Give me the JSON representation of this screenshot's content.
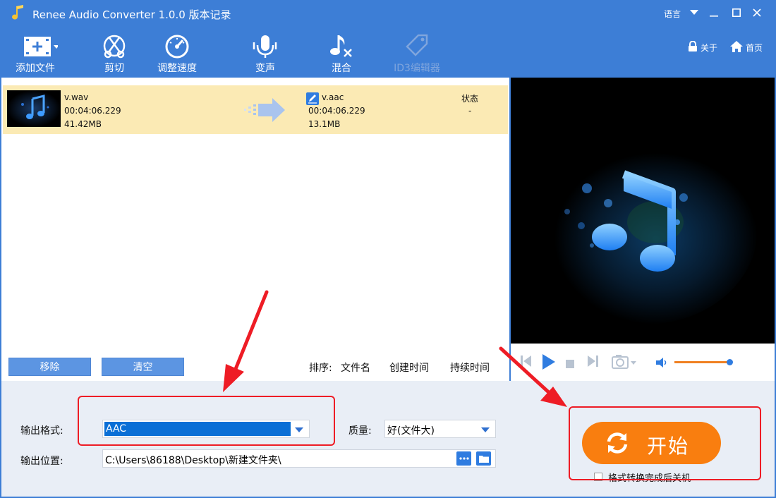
{
  "window": {
    "title": "Renee Audio Converter 1.0.0 版本记录",
    "language_label": "语言"
  },
  "toolbar": {
    "add_file": "添加文件",
    "cut": "剪切",
    "speed": "调整速度",
    "voice_change": "变声",
    "mix": "混合",
    "id3_editor": "ID3编辑器",
    "about": "关于",
    "home": "首页"
  },
  "file_list": {
    "items": [
      {
        "source_name": "v.wav",
        "source_duration": "00:04:06.229",
        "source_size": "41.42MB",
        "output_name": "v.aac",
        "output_duration": "00:04:06.229",
        "output_size": "13.1MB",
        "status_header": "状态",
        "status_value": "-"
      }
    ],
    "remove_label": "移除",
    "clear_label": "清空",
    "sort_label": "排序:",
    "sort_by_name": "文件名",
    "sort_by_created": "创建时间",
    "sort_by_duration": "持续时间"
  },
  "player": {
    "volume_level": 0.95
  },
  "settings": {
    "format_label": "输出格式:",
    "format_value": "AAC",
    "quality_label": "质量:",
    "quality_value": "好(文件大)",
    "location_label": "输出位置:",
    "location_value": "C:\\Users\\86188\\Desktop\\新建文件夹\\",
    "start_label": "开始",
    "shutdown_label": "格式转换完成后关机"
  },
  "colors": {
    "accent": "#3d7ed6",
    "start_button": "#f97e0f",
    "selected_row": "#fbeab4",
    "annotation": "#ee1c25"
  }
}
